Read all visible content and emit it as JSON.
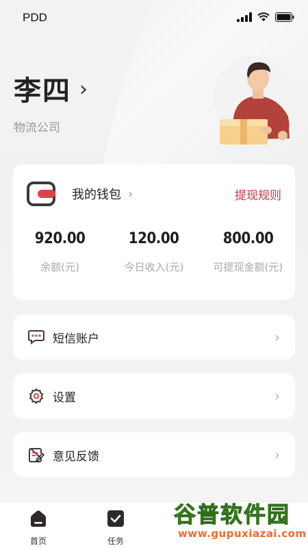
{
  "status_bar": {
    "carrier": "PDD"
  },
  "profile": {
    "name": "李四",
    "company": "物流公司"
  },
  "wallet": {
    "title": "我的钱包",
    "rule_link": "提现规则",
    "stats": [
      {
        "value": "920.00",
        "label": "余额(元)"
      },
      {
        "value": "120.00",
        "label": "今日收入(元)"
      },
      {
        "value": "800.00",
        "label": "可提现金额(元)"
      }
    ]
  },
  "menu": [
    {
      "label": "短信账户",
      "icon": "message-icon"
    },
    {
      "label": "设置",
      "icon": "gear-icon"
    },
    {
      "label": "意见反馈",
      "icon": "feedback-icon"
    }
  ],
  "tabbar": {
    "tabs": [
      {
        "label": "首页"
      },
      {
        "label": "任务"
      }
    ]
  },
  "watermark": {
    "name": "谷普软件园",
    "url": "www.gupuxiazai.com"
  },
  "colors": {
    "accent": "#c4393e",
    "dark": "#3a3a3a",
    "watermark_green": "#5aa832",
    "watermark_orange": "#f06a2a"
  }
}
